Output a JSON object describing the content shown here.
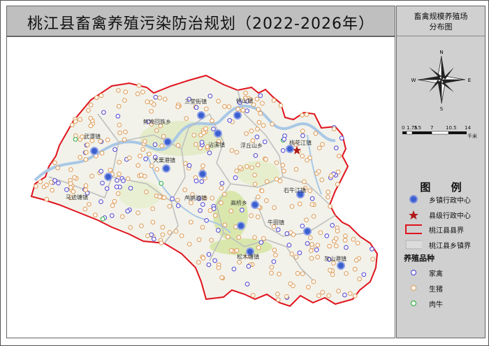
{
  "title": "桃江县畜禽养殖污染防治规划（2022-2026年）",
  "side_title": [
    "畜禽规模养殖场",
    "分布图"
  ],
  "compass": {
    "n": "N",
    "s": "S",
    "e": "E",
    "w": "W"
  },
  "scale": {
    "ticks": [
      "0",
      "1.75",
      "3.5",
      "7",
      "10.5",
      "14"
    ],
    "unit": "千米"
  },
  "legend": {
    "title": "图 例",
    "items": [
      {
        "label": "乡镇行政中心",
        "icon": "township-center-icon"
      },
      {
        "label": "县级行政中心",
        "icon": "county-center-star-icon"
      },
      {
        "label": "桃江县县界",
        "icon": "county-boundary-icon"
      },
      {
        "label": "桃江县乡镇界",
        "icon": "township-boundary-icon"
      }
    ],
    "species_title": "养殖品种",
    "species": [
      {
        "label": "家禽",
        "color": "#5a4fd6"
      },
      {
        "label": "生猪",
        "color": "#e0a060"
      },
      {
        "label": "肉牛",
        "color": "#34b34a"
      }
    ]
  },
  "towns": [
    "三堂街镇",
    "修山镇",
    "鲊埠回族乡",
    "武潭镇",
    "沾溪镇",
    "浮丘山乡",
    "桃花江镇",
    "大栗港镇",
    "马迹塘镇",
    "鸬鹚渡镇",
    "高桥乡",
    "石牛江镇",
    "牛田镇",
    "松木塘镇",
    "灰山港镇"
  ],
  "colors": {
    "boundary": "#e0141e",
    "fill": "#f2f2ea",
    "water": "#a9c8e6",
    "green": "#d6e6a6",
    "township_line": "#c8c8c8"
  }
}
